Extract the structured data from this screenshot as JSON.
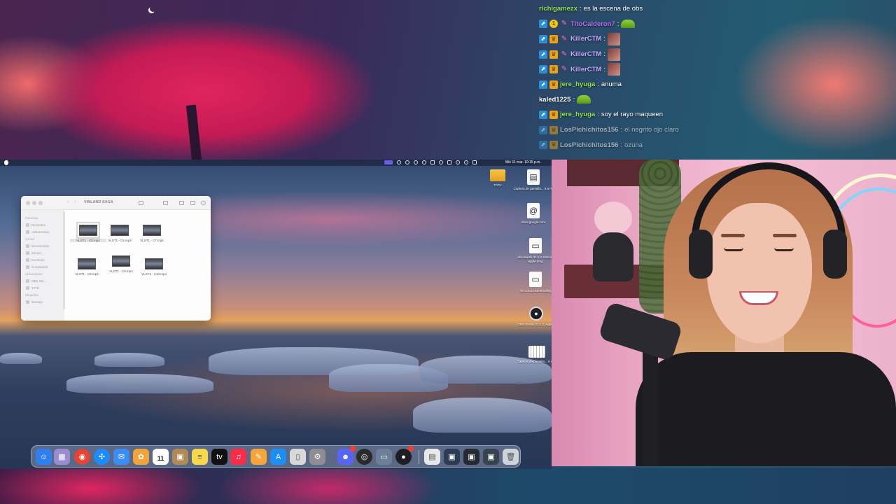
{
  "chat": {
    "messages": [
      {
        "name": "richigamezx",
        "name_color": "#8fe24a",
        "text": "es la escena de obs",
        "badges": [],
        "emote": null,
        "faded": false
      },
      {
        "name": "TitoCalderon7",
        "name_color": "#b46cf0",
        "text": "",
        "badges": [
          "prime",
          "coin",
          "brush"
        ],
        "emote": "hat",
        "faded": false
      },
      {
        "name": "KillerCTM",
        "name_color": "#c9a6ff",
        "text": "",
        "badges": [
          "prime",
          "crown",
          "brush"
        ],
        "emote": "face",
        "faded": false
      },
      {
        "name": "KillerCTM",
        "name_color": "#c9a6ff",
        "text": "",
        "badges": [
          "prime",
          "crown",
          "brush"
        ],
        "emote": "face",
        "faded": false
      },
      {
        "name": "KillerCTM",
        "name_color": "#c9a6ff",
        "text": "",
        "badges": [
          "prime",
          "crown",
          "brush"
        ],
        "emote": "face",
        "faded": false
      },
      {
        "name": "jere_hyuga",
        "name_color": "#8fe24a",
        "text": "anuma",
        "badges": [
          "prime",
          "crown"
        ],
        "emote": null,
        "faded": false
      },
      {
        "name": "kaled1225",
        "name_color": "#ffffff",
        "text": "",
        "badges": [],
        "emote": "hat",
        "faded": false
      },
      {
        "name": "jere_hyuga",
        "name_color": "#8fe24a",
        "text": "soy el rayo maqueen",
        "badges": [
          "prime",
          "crown"
        ],
        "emote": null,
        "faded": false
      },
      {
        "name": "LosPichichitos156",
        "name_color": "#ffffff",
        "text": "el negrito ojo claro",
        "badges": [
          "prime",
          "crown"
        ],
        "emote": null,
        "faded": true
      },
      {
        "name": "LosPichichitos156",
        "name_color": "#ffffff",
        "text": "ozuna",
        "badges": [
          "prime",
          "crown"
        ],
        "emote": null,
        "faded": true
      }
    ]
  },
  "mac": {
    "menubar": {
      "clock": "Mié 11 mar.  10:15 p.m."
    },
    "finder": {
      "title": "VINLAND SAGA",
      "sidebar": [
        {
          "type": "head",
          "label": "Favoritos"
        },
        {
          "type": "item",
          "label": "Recientes"
        },
        {
          "type": "item",
          "label": "Aplicaciones"
        },
        {
          "type": "head",
          "label": "iCloud"
        },
        {
          "type": "item",
          "label": "Documentos"
        },
        {
          "type": "item",
          "label": "iCloud..."
        },
        {
          "type": "item",
          "label": "Escritorio"
        },
        {
          "type": "item",
          "label": "Compartido"
        },
        {
          "type": "head",
          "label": "Ubicaciones"
        },
        {
          "type": "item",
          "label": "OBS Stu..."
        },
        {
          "type": "item",
          "label": "TATU"
        },
        {
          "type": "head",
          "label": "Etiquetas"
        },
        {
          "type": "item",
          "label": "Naranja"
        }
      ],
      "files": [
        {
          "label": "VLST1 - C5.mp4",
          "selected": true
        },
        {
          "label": "VLST1 - C6.mp4",
          "selected": false
        },
        {
          "label": "VLST1 - C7.mp4",
          "selected": false
        },
        {
          "label": "VLST1 - C8.mp4",
          "selected": false
        },
        {
          "label": "VLST1 - C9.mp4",
          "selected": false
        },
        {
          "label": "VLST1 - C10.mp4",
          "selected": false
        }
      ]
    },
    "desktop_icons": [
      {
        "label": "TATU",
        "icon": "folder-icon",
        "glyph": ""
      },
      {
        "label": "Captura de pantalla... 9 a.m.",
        "icon": "screenshot-icon",
        "glyph": "▤"
      },
      {
        "label": "docs.google.com",
        "icon": "link-icon",
        "glyph": "@"
      },
      {
        "label": "obs-studio-31.1.2-macos-apple.dmg",
        "icon": "dmg-file-icon",
        "glyph": "▭"
      },
      {
        "label": "vlc-3.0.21-arm64.dmg",
        "icon": "dmg-file-icon",
        "glyph": "▭"
      },
      {
        "label": "OBS Studio 31.1.2 (Apple)",
        "icon": "obs-icon",
        "glyph": "●"
      },
      {
        "label": "Captura de pantalla... 9 a.m.",
        "icon": "screenshot-icon",
        "glyph": ""
      }
    ],
    "dock": {
      "calendar_day": "11",
      "apps": [
        {
          "name": "finder",
          "icon": "finder-icon",
          "color": "#2f7ff0",
          "glyph": "☺"
        },
        {
          "name": "launchpad",
          "icon": "launchpad-icon",
          "color": "#9a8ccf",
          "glyph": "▦"
        },
        {
          "name": "chrome",
          "icon": "chrome-icon",
          "color": "#e94235",
          "glyph": "◉"
        },
        {
          "name": "safari",
          "icon": "safari-icon",
          "color": "#1a8cff",
          "glyph": "✣"
        },
        {
          "name": "mail",
          "icon": "mail-icon",
          "color": "#3a8df5",
          "glyph": "✉"
        },
        {
          "name": "photos",
          "icon": "photos-icon",
          "color": "#f2a33a",
          "glyph": "✿"
        },
        {
          "name": "calendar",
          "icon": "calendar-icon",
          "color": "#ffffff",
          "glyph": ""
        },
        {
          "name": "notes-brown",
          "icon": "contacts-icon",
          "color": "#b08a55",
          "glyph": "▣"
        },
        {
          "name": "notes",
          "icon": "notes-icon",
          "color": "#f7d84a",
          "glyph": "≡"
        },
        {
          "name": "apple-tv",
          "icon": "apple-tv-icon",
          "color": "#111111",
          "glyph": "tv"
        },
        {
          "name": "music",
          "icon": "music-icon",
          "color": "#fa2d48",
          "glyph": "♫"
        },
        {
          "name": "pages",
          "icon": "pages-icon",
          "color": "#f6a53a",
          "glyph": "✎"
        },
        {
          "name": "app-store",
          "icon": "app-store-icon",
          "color": "#1e8ef7",
          "glyph": "A"
        },
        {
          "name": "preview",
          "icon": "preview-icon",
          "color": "#d8d8d8",
          "glyph": "▯"
        },
        {
          "name": "system-settings",
          "icon": "gear-icon",
          "color": "#8d8d93",
          "glyph": "⚙"
        },
        {
          "name": "discord",
          "icon": "discord-icon",
          "color": "#5865f2",
          "glyph": "☻"
        },
        {
          "name": "quicktime",
          "icon": "quicktime-icon",
          "color": "#2a2a2a",
          "glyph": "◎"
        },
        {
          "name": "migration",
          "icon": "display-icon",
          "color": "#6d7f98",
          "glyph": "▭"
        },
        {
          "name": "obs",
          "icon": "obs-icon",
          "color": "#1d1d24",
          "glyph": "●"
        },
        {
          "name": "doc",
          "icon": "document-icon",
          "color": "#e8e8e8",
          "glyph": "▤"
        },
        {
          "name": "window-1",
          "icon": "window-thumbnail-icon",
          "color": "#2d3b55",
          "glyph": "▣"
        },
        {
          "name": "window-2",
          "icon": "window-thumbnail-icon",
          "color": "#262a33",
          "glyph": "▣"
        },
        {
          "name": "window-3",
          "icon": "window-thumbnail-icon",
          "color": "#39424f",
          "glyph": "▣"
        },
        {
          "name": "trash",
          "icon": "trash-icon",
          "color": "#cfd3da",
          "glyph": "🗑"
        }
      ]
    }
  }
}
